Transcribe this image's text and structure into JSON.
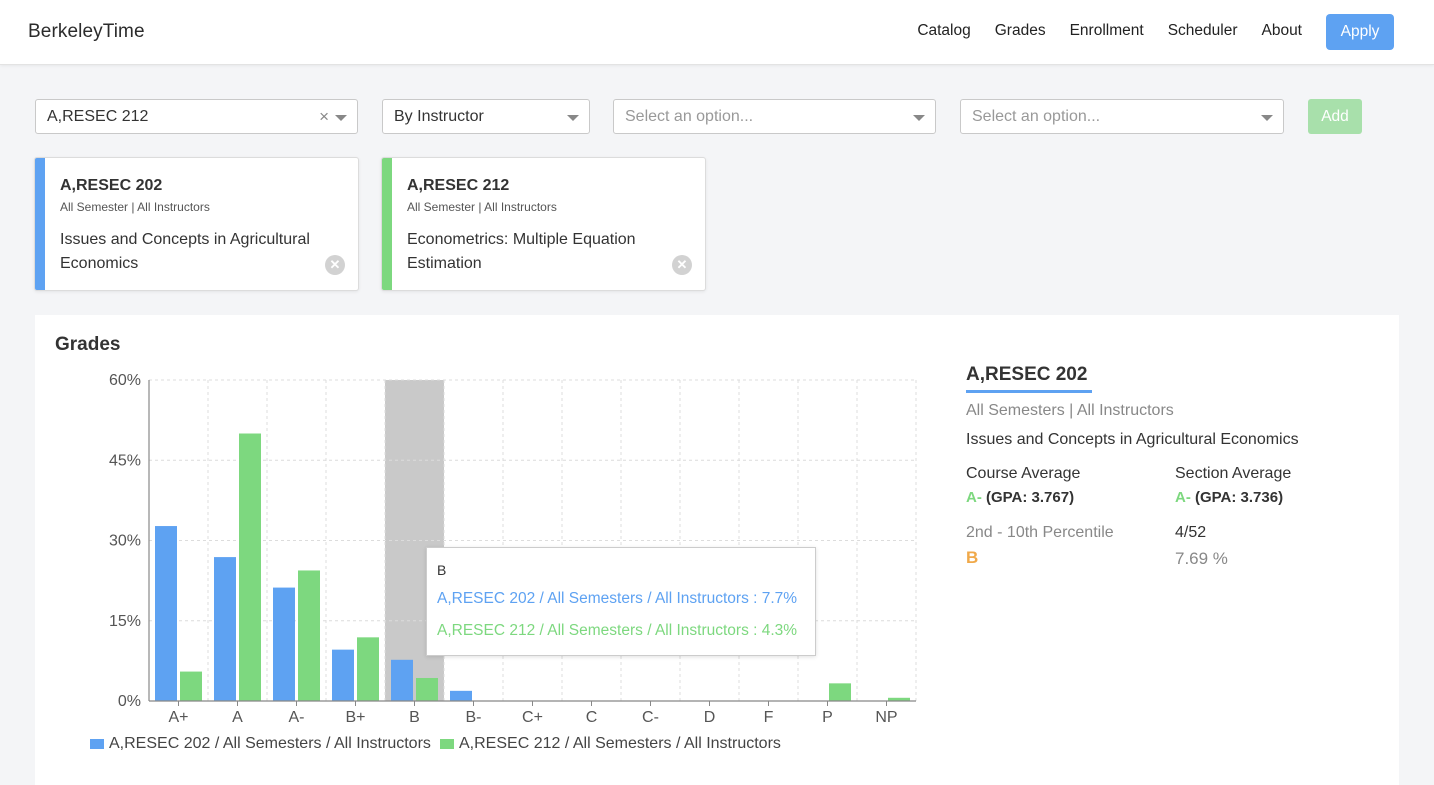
{
  "nav": {
    "brand": "BerkeleyTime",
    "links": [
      "Catalog",
      "Grades",
      "Enrollment",
      "Scheduler",
      "About"
    ],
    "apply": "Apply"
  },
  "filters": {
    "course": "A,RESEC 212",
    "clear": "×",
    "mode": "By Instructor",
    "placeholder1": "Select an option...",
    "placeholder2": "Select an option...",
    "add": "Add"
  },
  "cards": [
    {
      "title": "A,RESEC 202",
      "sub": "All Semester | All Instructors",
      "desc": "Issues and Concepts in Agricultural Economics",
      "color": "#5ea2f2"
    },
    {
      "title": "A,RESEC 212",
      "sub": "All Semester | All Instructors",
      "desc": "Econometrics: Multiple Equation Estimation",
      "color": "#7dd87f"
    }
  ],
  "panel": {
    "title": "Grades"
  },
  "chart_data": {
    "type": "bar",
    "categories": [
      "A+",
      "A",
      "A-",
      "B+",
      "B",
      "B-",
      "C+",
      "C",
      "C-",
      "D",
      "F",
      "P",
      "NP"
    ],
    "series": [
      {
        "name": "A,RESEC 202 / All Semesters / All Instructors",
        "color": "#5ea2f2",
        "values": [
          32.7,
          26.9,
          21.2,
          9.6,
          7.7,
          1.9,
          0,
          0,
          0,
          0,
          0,
          0,
          0
        ]
      },
      {
        "name": "A,RESEC 212 / All Semesters / All Instructors",
        "color": "#7dd87f",
        "values": [
          5.5,
          50.0,
          24.4,
          11.9,
          4.3,
          0,
          0,
          0,
          0,
          0,
          0,
          3.3,
          0.6
        ]
      }
    ],
    "yticks": [
      "0%",
      "15%",
      "30%",
      "45%",
      "60%"
    ],
    "ylim": [
      0,
      60
    ],
    "highlight": "B",
    "grid": true,
    "legend": "bottom"
  },
  "tooltip": {
    "title": "B",
    "row1": "A,RESEC 202 / All Semesters / All Instructors : 7.7%",
    "row2": "A,RESEC 212 / All Semesters / All Instructors : 4.3%"
  },
  "info": {
    "title": "A,RESEC 202",
    "sub": "All Semesters | All Instructors",
    "desc": "Issues and Concepts in Agricultural Economics",
    "course_avg_label": "Course Average",
    "course_avg_grade": "A-",
    "course_avg_gpa": "(GPA: 3.767)",
    "section_avg_label": "Section Average",
    "section_avg_grade": "A-",
    "section_avg_gpa": "(GPA: 3.736)",
    "percentile_label": "2nd - 10th Percentile",
    "percentile_grade": "B",
    "count": "4/52",
    "percent": "7.69 %"
  }
}
